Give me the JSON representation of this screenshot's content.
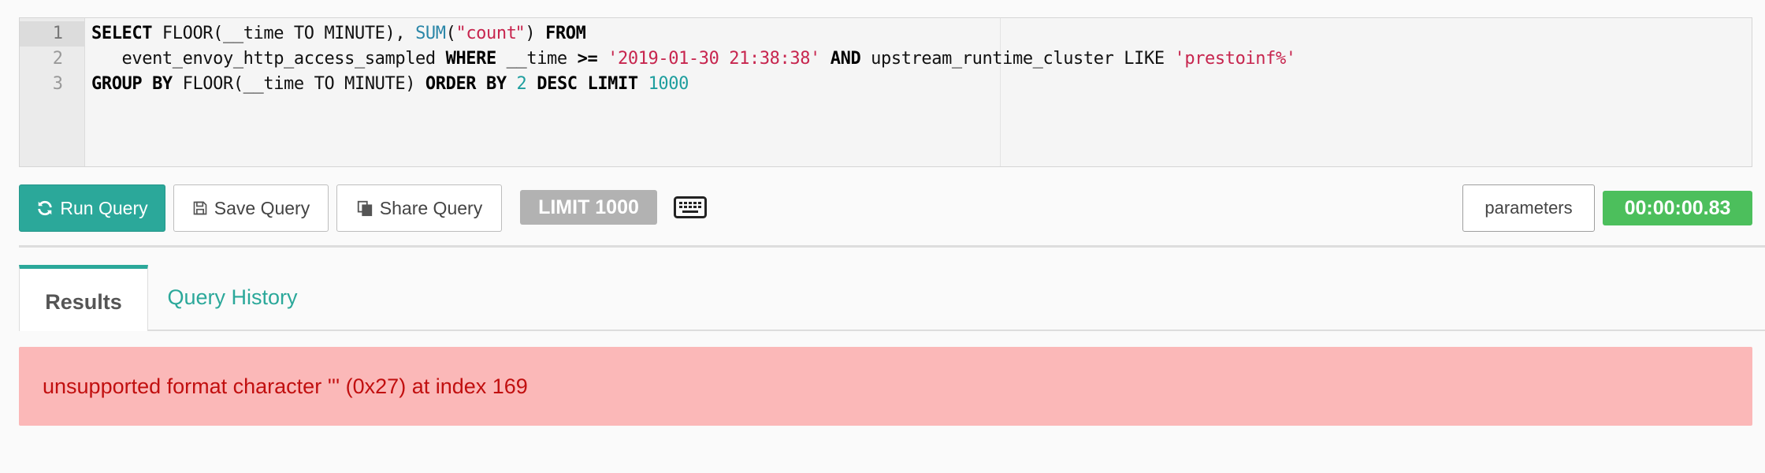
{
  "editor": {
    "line_numbers": [
      "1",
      "2",
      "3"
    ],
    "lines": [
      [
        {
          "t": "SELECT",
          "c": "kw"
        },
        {
          "t": " FLOOR(",
          "c": ""
        },
        {
          "t": "__time TO MINUTE), ",
          "c": ""
        },
        {
          "t": "SUM",
          "c": "fn"
        },
        {
          "t": "(",
          "c": ""
        },
        {
          "t": "\"count",
          "c": "str"
        },
        {
          "t": "|",
          "c": "cursor"
        },
        {
          "t": "\"",
          "c": "str"
        },
        {
          "t": ") ",
          "c": ""
        },
        {
          "t": "FROM",
          "c": "kw"
        }
      ],
      [
        {
          "t": "   event_envoy_http_access_sampled ",
          "c": ""
        },
        {
          "t": "WHERE",
          "c": "kw"
        },
        {
          "t": " __time ",
          "c": ""
        },
        {
          "t": ">=",
          "c": "kw"
        },
        {
          "t": " ",
          "c": ""
        },
        {
          "t": "'2019-01-30 21:38:38'",
          "c": "str"
        },
        {
          "t": " ",
          "c": ""
        },
        {
          "t": "AND",
          "c": "kw"
        },
        {
          "t": " upstream_runtime_cluster LIKE ",
          "c": ""
        },
        {
          "t": "'prestoinf%'",
          "c": "str"
        }
      ],
      [
        {
          "t": "GROUP BY",
          "c": "kw"
        },
        {
          "t": " FLOOR(__time TO MINUTE) ",
          "c": ""
        },
        {
          "t": "ORDER BY",
          "c": "kw"
        },
        {
          "t": " ",
          "c": ""
        },
        {
          "t": "2",
          "c": "num"
        },
        {
          "t": " ",
          "c": ""
        },
        {
          "t": "DESC LIMIT",
          "c": "kw"
        },
        {
          "t": " ",
          "c": ""
        },
        {
          "t": "1000",
          "c": "num"
        }
      ]
    ]
  },
  "toolbar": {
    "run_label": "Run Query",
    "save_label": "Save Query",
    "share_label": "Share Query",
    "limit_label": "LIMIT 1000",
    "parameters_label": "parameters",
    "timer": "00:00:00.83"
  },
  "tabs": {
    "results": "Results",
    "history": "Query History"
  },
  "error": {
    "message": "unsupported format character ''' (0x27) at index 169"
  },
  "colors": {
    "accent": "#2ba89a",
    "timer_bg": "#4cbf5c",
    "error_bg": "#fbb8b8",
    "error_text": "#c10f0f"
  },
  "icons": {
    "run": "refresh-icon",
    "save": "floppy-disk-icon",
    "share": "copy-icon",
    "keyboard": "keyboard-icon"
  }
}
